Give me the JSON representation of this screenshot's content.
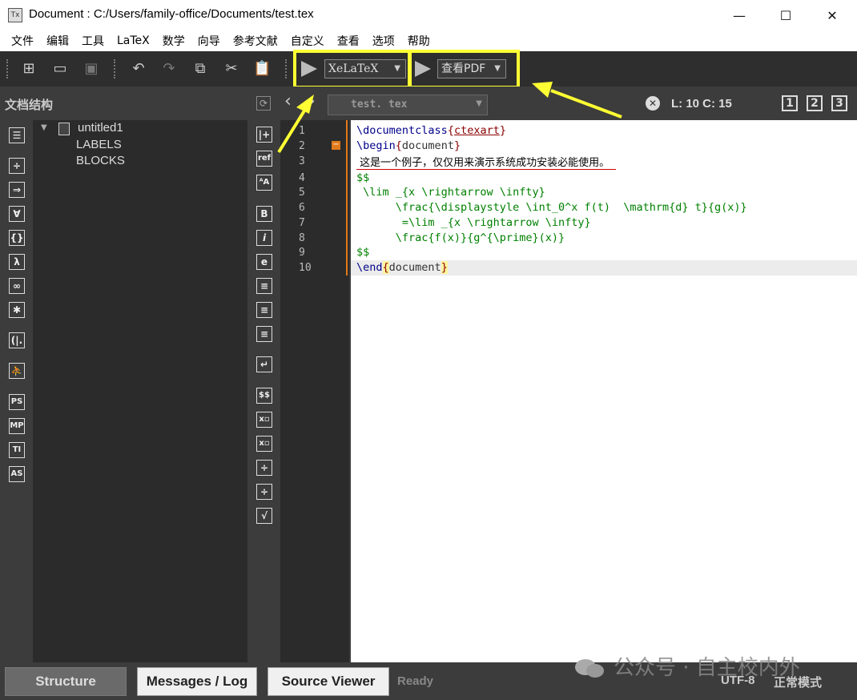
{
  "window": {
    "title": "Document : C:/Users/family-office/Documents/test.tex",
    "minimize": "—",
    "maximize": "☐",
    "close": "✕"
  },
  "menu": [
    "文件",
    "编辑",
    "工具",
    "LaTeX",
    "数学",
    "向导",
    "参考文献",
    "自定义",
    "查看",
    "选项",
    "帮助"
  ],
  "toolbar": {
    "compiler": "XeLaTeX",
    "viewer": "查看PDF"
  },
  "structure": {
    "title": "文档结构",
    "root": "untitled1",
    "children": [
      "LABELS",
      "BLOCKS"
    ]
  },
  "editor": {
    "tab_file": "test. tex",
    "cursor": "L: 10 C: 15",
    "views": [
      "1",
      "2",
      "3"
    ],
    "line_numbers": [
      "1",
      "2",
      "3",
      "4",
      "5",
      "6",
      "7",
      "8",
      "9",
      "10"
    ]
  },
  "status": {
    "structure_btn": "Structure",
    "messages_btn": "Messages / Log",
    "source_btn": "Source Viewer",
    "state": "Ready",
    "encoding": "UTF-8",
    "mode": "正常模式",
    "watermark": "公众号 · 自主校内外"
  },
  "colors": {
    "highlight": "#ffff33",
    "command": "#00008b",
    "brace": "#8b0000",
    "math": "#008000",
    "text": "#000000"
  }
}
